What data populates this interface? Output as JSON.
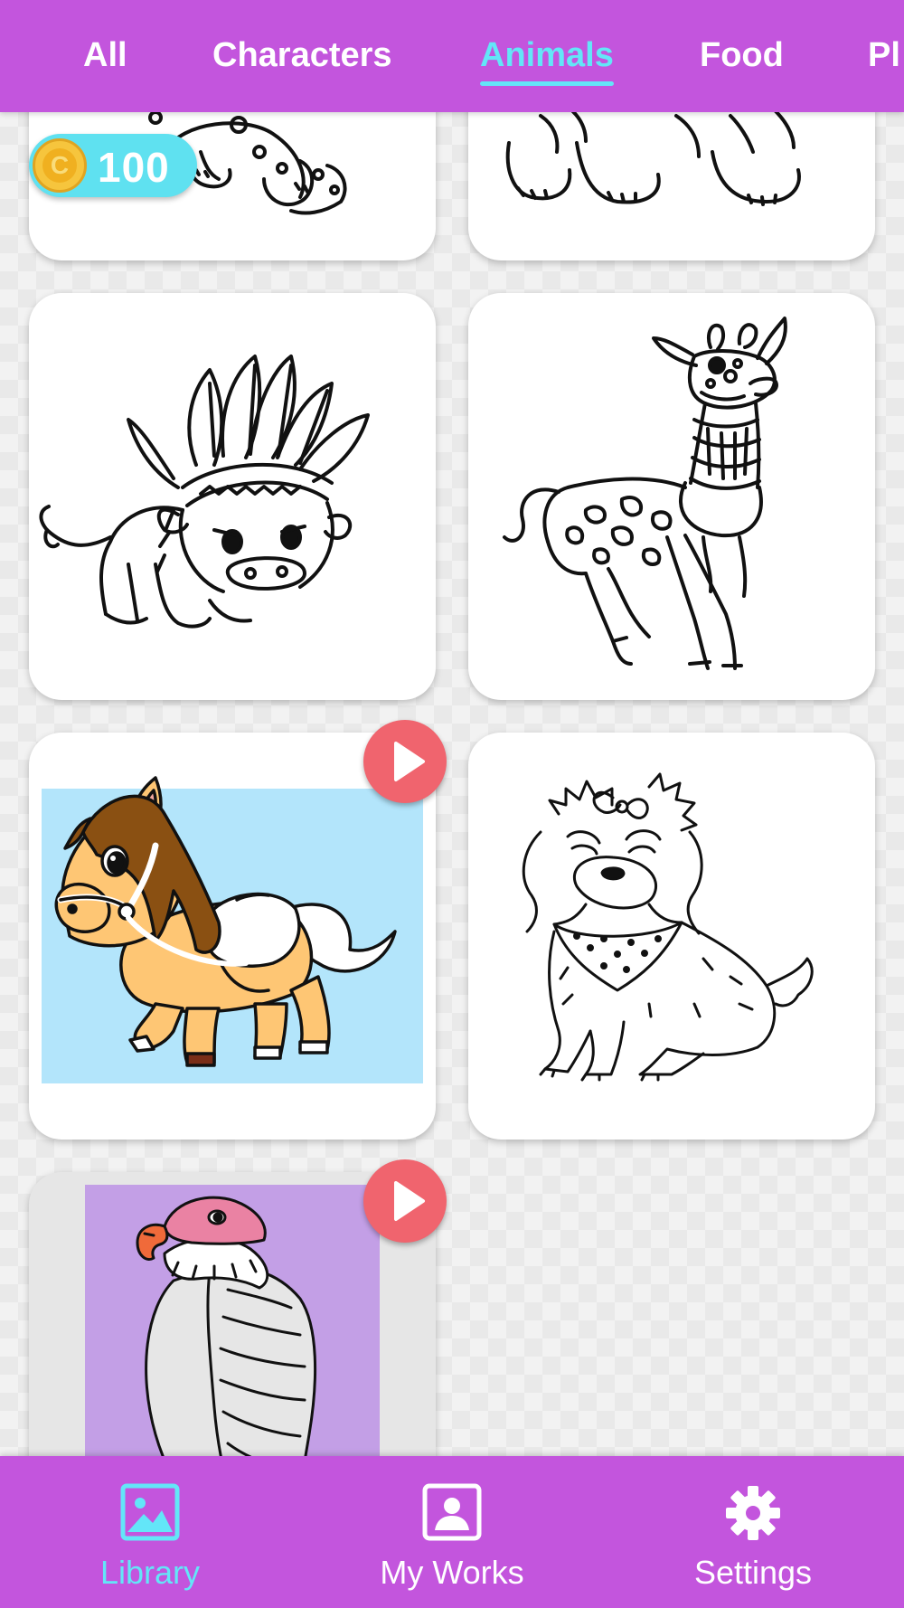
{
  "tabs": {
    "items": [
      {
        "label": "All",
        "active": false
      },
      {
        "label": "Characters",
        "active": false
      },
      {
        "label": "Animals",
        "active": true
      },
      {
        "label": "Food",
        "active": false
      },
      {
        "label": "Pl",
        "active": false
      }
    ]
  },
  "coins": {
    "symbol": "C",
    "amount": "100"
  },
  "cards": [
    {
      "subject": "animal-line-art-partial",
      "locked": false
    },
    {
      "subject": "tiger-line-art-partial",
      "locked": false
    },
    {
      "subject": "buffalo-with-feather-headdress",
      "locked": false
    },
    {
      "subject": "giraffe-with-scarf",
      "locked": false
    },
    {
      "subject": "colored-pony",
      "locked": true
    },
    {
      "subject": "fluffy-dog-with-bow",
      "locked": false
    },
    {
      "subject": "colored-vulture",
      "locked": true
    }
  ],
  "bottom_nav": {
    "items": [
      {
        "label": "Library",
        "icon": "image-icon",
        "active": true
      },
      {
        "label": "My Works",
        "icon": "portrait-icon",
        "active": false
      },
      {
        "label": "Settings",
        "icon": "gear-icon",
        "active": false
      }
    ]
  },
  "colors": {
    "brand_purple": "#c355dd",
    "accent_cyan": "#63e6f8",
    "play_red": "#f0646e",
    "coin_gold": "#f6c53d"
  }
}
